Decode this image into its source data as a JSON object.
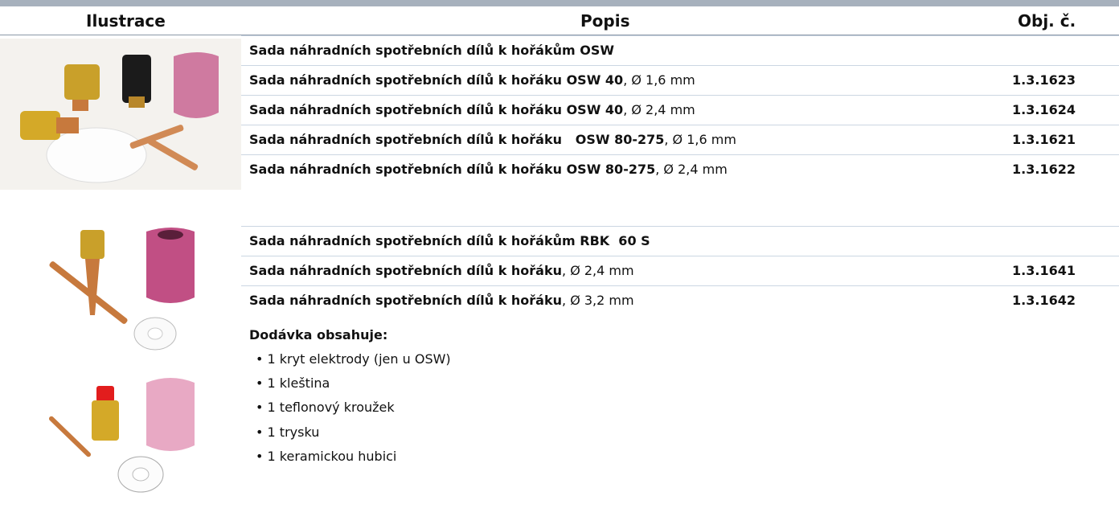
{
  "header": {
    "col1": "Ilustrace",
    "col2": "Popis",
    "col3": "Obj. č."
  },
  "group1": {
    "title": "Sada náhradních spotřebních dílů k hořákům OSW",
    "rows": [
      {
        "bold": "Sada náhradních spotřebních dílů k hořáku OSW 40",
        "rest": ", Ø 1,6 mm",
        "code": "1.3.1623"
      },
      {
        "bold": "Sada náhradních spotřebních dílů k hořáku OSW 40",
        "rest": ", Ø 2,4 mm",
        "code": "1.3.1624"
      },
      {
        "bold": "Sada náhradních spotřebních dílů k hořáku   OSW 80-275",
        "rest": ", Ø 1,6 mm",
        "code": "1.3.1621"
      },
      {
        "bold": "Sada náhradních spotřebních dílů k hořáku OSW 80-275",
        "rest": ", Ø 2,4 mm",
        "code": "1.3.1622"
      }
    ]
  },
  "group2": {
    "title": "Sada náhradních spotřebních dílů k hořákům RBK  60 S",
    "rows": [
      {
        "bold": "Sada náhradních spotřebních dílů k hořáku",
        "rest": ", Ø 2,4 mm",
        "code": "1.3.1641"
      },
      {
        "bold": "Sada náhradních spotřebních dílů k hořáku",
        "rest": ", Ø 3,2 mm",
        "code": "1.3.1642"
      }
    ]
  },
  "delivery": {
    "title": "Dodávka obsahuje:",
    "items": [
      "• 1 kryt elektrody (jen u OSW)",
      "• 1 kleština",
      "• 1 teflonový kroužek",
      "• 1 trysku",
      "• 1 keramickou hubici"
    ]
  }
}
